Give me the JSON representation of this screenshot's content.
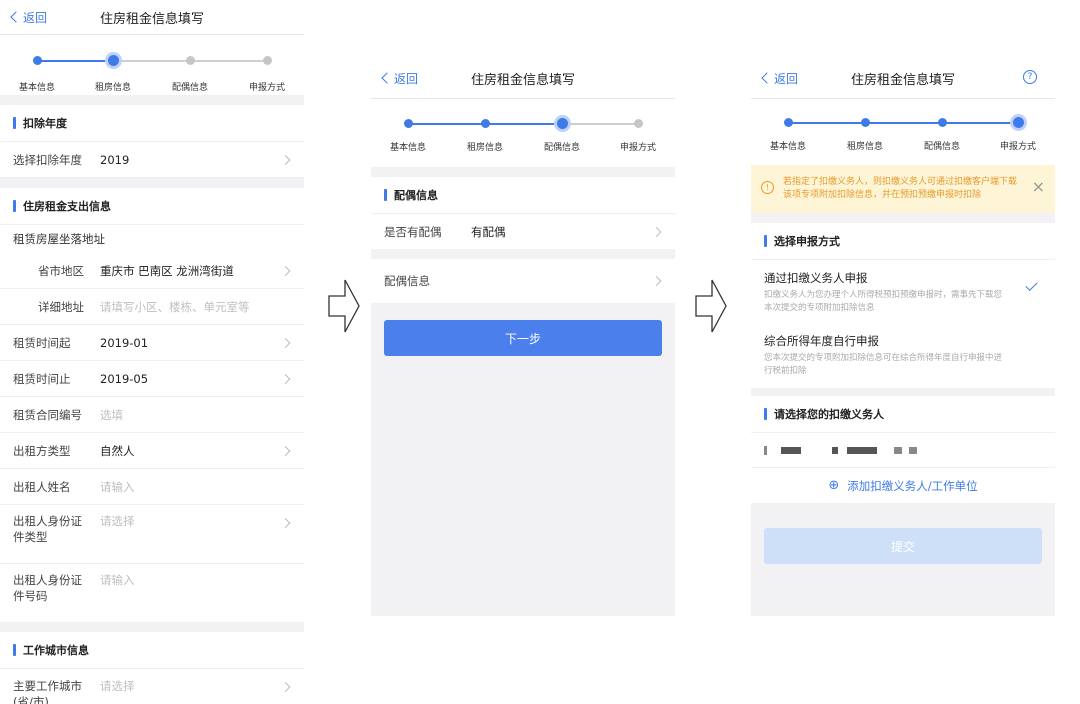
{
  "common": {
    "back": "返回",
    "title": "住房租金信息填写"
  },
  "panel1": {
    "steps": [
      "基本信息",
      "租房信息",
      "配偶信息",
      "申报方式"
    ],
    "sec_year": {
      "title": "扣除年度",
      "row": {
        "label": "选择扣除年度",
        "value": "2019"
      }
    },
    "sec_rent": {
      "title": "住房租金支出信息",
      "address_label": "租赁房屋坐落地址",
      "rows": [
        {
          "label": "省市地区",
          "value": "重庆市 巴南区 龙洲湾街道"
        },
        {
          "label": "详细地址",
          "value": "请填写小区、楼栋、单元室等"
        },
        {
          "label": "租赁时间起",
          "value": "2019-01"
        },
        {
          "label": "租赁时间止",
          "value": "2019-05"
        },
        {
          "label": "租赁合同编号",
          "value": "选填"
        },
        {
          "label": "出租方类型",
          "value": "自然人"
        },
        {
          "label": "出租人姓名",
          "value": "请输入"
        },
        {
          "label": "出租人身份证件类型",
          "value": "请选择"
        },
        {
          "label": "出租人身份证件号码",
          "value": "请输入"
        }
      ]
    },
    "sec_city": {
      "title": "工作城市信息",
      "row": {
        "label": "主要工作城市(省/市)",
        "value": "请选择"
      }
    }
  },
  "panel2": {
    "steps": [
      "基本信息",
      "租房信息",
      "配偶信息",
      "申报方式"
    ],
    "sec": {
      "title": "配偶信息",
      "row1": {
        "label": "是否有配偶",
        "value": "有配偶"
      },
      "row2": {
        "label": "配偶信息"
      }
    },
    "next": "下一步"
  },
  "panel3": {
    "steps": [
      "基本信息",
      "租房信息",
      "配偶信息",
      "申报方式"
    ],
    "help": "?",
    "notice": "若指定了扣缴义务人，则扣缴义务人可通过扣缴客户端下载该项专项附加扣除信息，并在预扣预缴申报时扣除",
    "notice_close": "×",
    "sec_method": {
      "title": "选择申报方式",
      "opt1": {
        "title": "通过扣缴义务人申报",
        "desc": "扣缴义务人为您办理个人所得税预扣预缴申报时，需事先下载您本次提交的专项附加扣除信息"
      },
      "opt2": {
        "title": "综合所得年度自行申报",
        "desc": "您本次提交的专项附加扣除信息可在综合所得年度自行申报中进行税前扣除"
      }
    },
    "sec_payer": {
      "title": "请选择您的扣缴义务人",
      "add": "添加扣缴义务人/工作单位",
      "add_icon": "⊕"
    },
    "submit": "提交"
  },
  "colors": {
    "accent": "#3e7ae8",
    "notice_bg": "#fdf5d6",
    "notice_text": "#e89a2c"
  }
}
